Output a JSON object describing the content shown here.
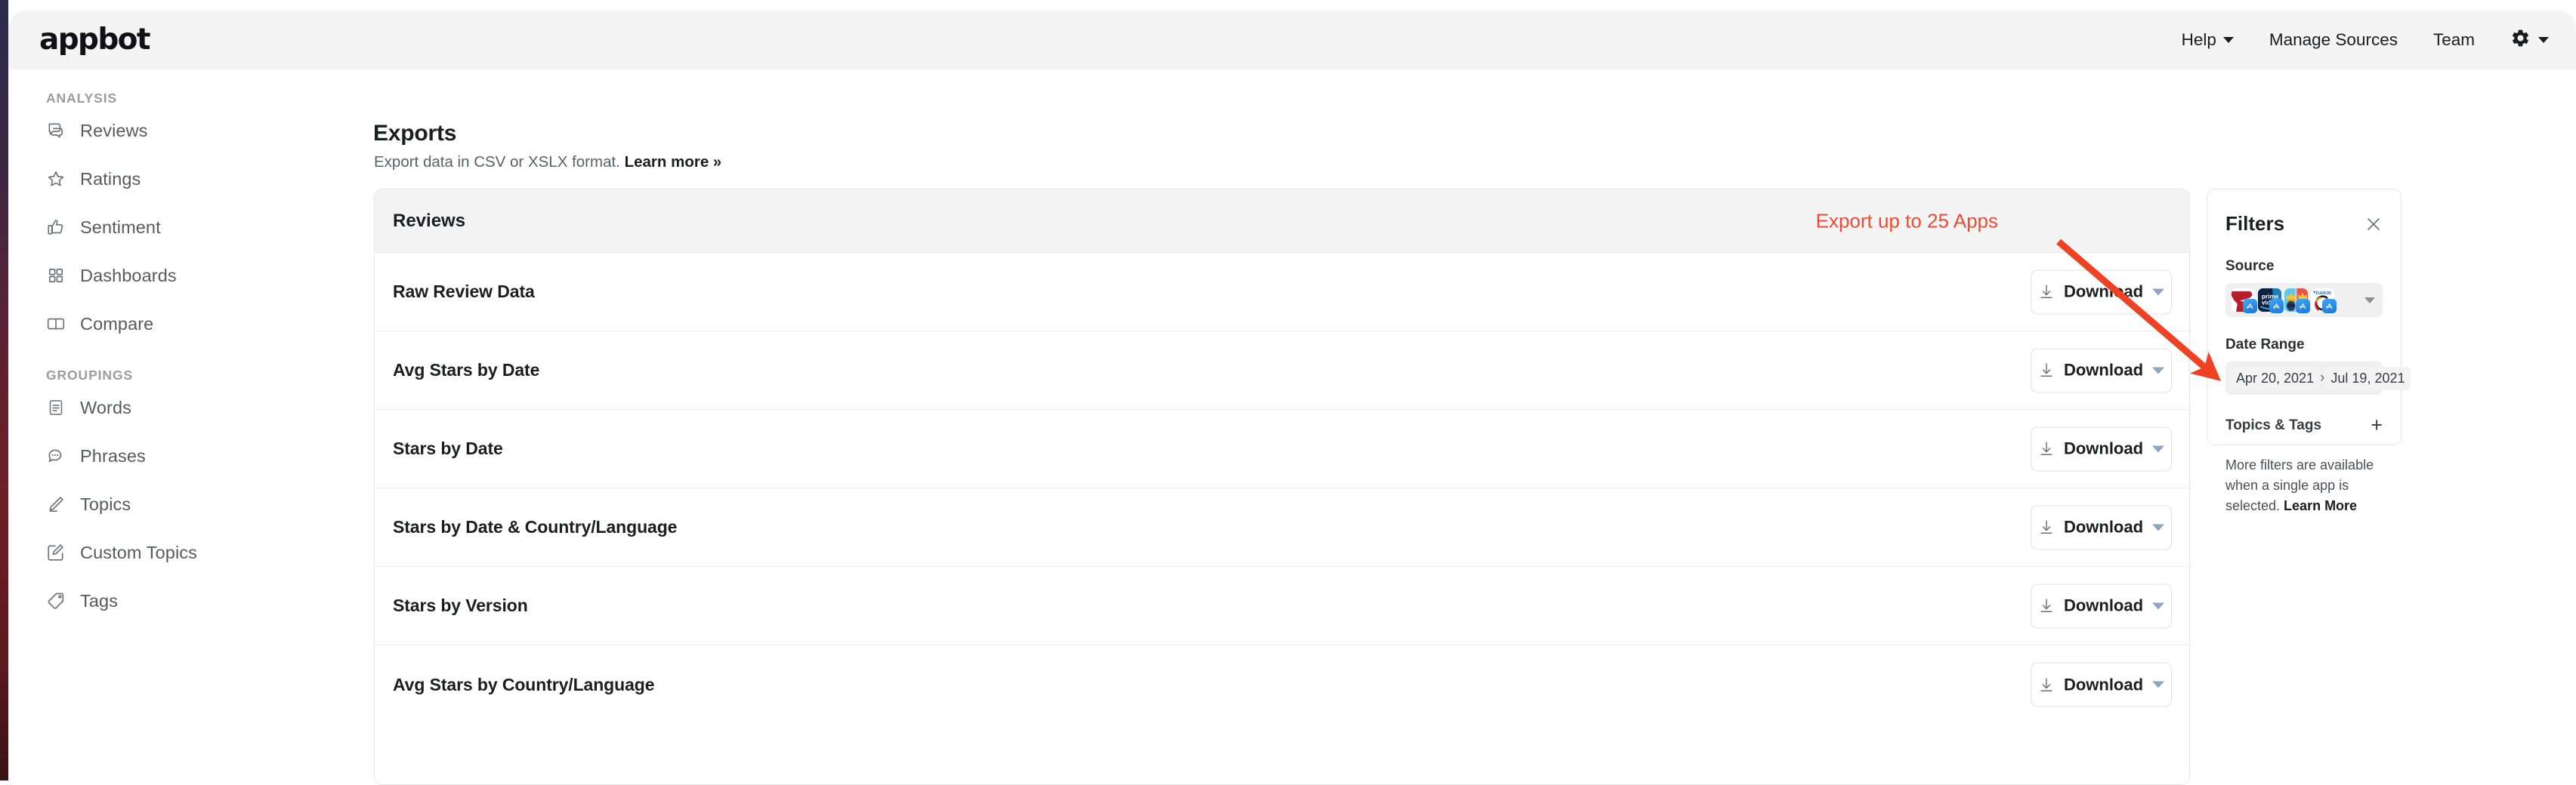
{
  "brand": "appbot",
  "topnav": [
    {
      "label": "Help",
      "icon": "chevron-down-icon",
      "has_caret": true
    },
    {
      "label": "Manage Sources",
      "has_caret": false
    },
    {
      "label": "Team",
      "has_caret": false
    }
  ],
  "topnav_gear": {
    "icon": "gear-icon",
    "caret": "chevron-down-icon"
  },
  "sidebar": {
    "groups": [
      {
        "label": "ANALYSIS",
        "items": [
          {
            "label": "Reviews",
            "icon": "chat-bubbles-icon"
          },
          {
            "label": "Ratings",
            "icon": "star-outline-icon"
          },
          {
            "label": "Sentiment",
            "icon": "thumbs-up-icon"
          },
          {
            "label": "Dashboards",
            "icon": "grid-squares-icon"
          },
          {
            "label": "Compare",
            "icon": "split-panel-icon"
          }
        ]
      },
      {
        "label": "GROUPINGS",
        "items": [
          {
            "label": "Words",
            "icon": "document-lines-icon"
          },
          {
            "label": "Phrases",
            "icon": "speech-bubble-dots-icon"
          },
          {
            "label": "Topics",
            "icon": "pencil-icon"
          },
          {
            "label": "Custom Topics",
            "icon": "pencil-square-icon"
          },
          {
            "label": "Tags",
            "icon": "tag-icon"
          }
        ]
      }
    ]
  },
  "page": {
    "title": "Exports",
    "subtitle_text": "Export data in CSV or XSLX format. ",
    "subtitle_link": "Learn more »"
  },
  "exports_card": {
    "title": "Reviews",
    "annotation": "Export up to 25 Apps",
    "annotation_color": "#ec4c34",
    "download_label": "Download",
    "download_icon": "download-arrow-icon",
    "rows": [
      {
        "label": "Raw Review Data"
      },
      {
        "label": "Avg Stars by Date"
      },
      {
        "label": "Stars by Date"
      },
      {
        "label": "Stars by Date & Country/Language"
      },
      {
        "label": "Stars by Version"
      },
      {
        "label": "Avg Stars by Country/Language"
      }
    ]
  },
  "filters": {
    "title": "Filters",
    "close_icon": "close-icon",
    "source_label": "Source",
    "source_apps": [
      {
        "name": "pinterest-app-icon",
        "store": "app-store-badge"
      },
      {
        "name": "prime-video-app-icon",
        "store": "app-store-badge",
        "line1": "prime",
        "line2": "vid"
      },
      {
        "name": "clash-royale-app-icon",
        "store": "app-store-badge"
      },
      {
        "name": "daikin-app-icon",
        "store": "app-store-badge",
        "label": "DAIKIN"
      }
    ],
    "date_range_label": "Date Range",
    "date_from": "Apr 20, 2021",
    "date_to": "Jul 19, 2021",
    "date_separator": "›",
    "topics_tags_label": "Topics & Tags",
    "topics_tags_add": "+",
    "note_text": "More filters are available when a single app is selected. ",
    "note_link": "Learn More"
  }
}
